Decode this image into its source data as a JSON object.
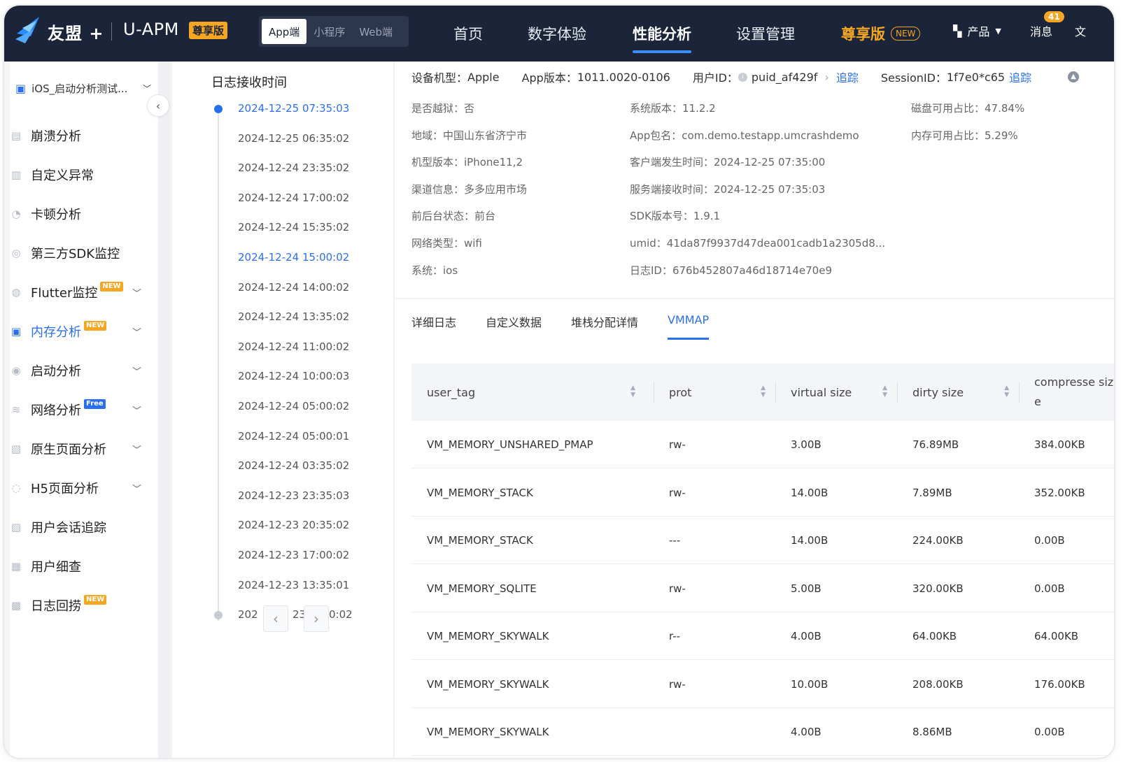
{
  "topbar": {
    "brand": "友盟 +",
    "product": "U-APM",
    "edition_badge": "尊享版",
    "segments": [
      "App端",
      "小程序",
      "Web端"
    ],
    "nav": [
      "首页",
      "数字体验",
      "性能分析",
      "设置管理"
    ],
    "vip_label": "尊享版",
    "vip_new": "NEW",
    "products": "产品",
    "messages": "消息",
    "message_count": "41",
    "docs": "文"
  },
  "sidebar": {
    "app_selector": "iOS_启动分析测试...",
    "items": [
      {
        "label": "崩溃分析",
        "icon": "crash-report-icon"
      },
      {
        "label": "自定义异常",
        "icon": "chart-icon"
      },
      {
        "label": "卡顿分析",
        "icon": "lag-icon"
      },
      {
        "label": "第三方SDK监控",
        "icon": "sdk-monitor-icon"
      },
      {
        "label": "Flutter监控",
        "icon": "flutter-icon",
        "tag": "NEW"
      },
      {
        "label": "内存分析",
        "icon": "memory-save-icon",
        "tag": "NEW"
      },
      {
        "label": "启动分析",
        "icon": "power-icon"
      },
      {
        "label": "网络分析",
        "icon": "wifi-icon",
        "tag": "Free"
      },
      {
        "label": "原生页面分析",
        "icon": "page-icon"
      },
      {
        "label": "H5页面分析",
        "icon": "h5-icon"
      },
      {
        "label": "用户会话追踪",
        "icon": "session-icon"
      },
      {
        "label": "用户细查",
        "icon": "user-detail-icon"
      },
      {
        "label": "日志回捞",
        "icon": "log-icon",
        "tag": "NEW"
      }
    ]
  },
  "timeline": {
    "title": "日志接收时间",
    "items": [
      "2024-12-25 07:35:03",
      "2024-12-25 06:35:02",
      "2024-12-24 23:35:02",
      "2024-12-24 17:00:02",
      "2024-12-24 15:35:02",
      "2024-12-24 15:00:02",
      "2024-12-24 14:00:02",
      "2024-12-24 13:35:02",
      "2024-12-24 11:00:02",
      "2024-12-24 10:00:03",
      "2024-12-24 05:00:02",
      "2024-12-24 05:00:01",
      "2024-12-24 03:35:02",
      "2024-12-23 23:35:03",
      "2024-12-23 20:35:02",
      "2024-12-23 17:00:02",
      "2024-12-23 13:35:01"
    ],
    "last_item_left": "202",
    "last_item_mid": "23",
    "last_item_right": "0:02"
  },
  "detail": {
    "device_model_label": "设备机型：",
    "device_model": "Apple",
    "app_version_label": "App版本：",
    "app_version": "1011.0020-0106",
    "user_id_label": "用户ID：",
    "user_id": "puid_af429f",
    "trace_label": "追踪",
    "session_label": "SessionID：",
    "session_id": "1f7e0*c65",
    "col1": [
      "是否越狱：否",
      "地域：中国山东省济宁市",
      "机型版本：iPhone11,2",
      "渠道信息：多多应用市场",
      "前后台状态：前台",
      "网络类型：wifi",
      "系统：ios"
    ],
    "col2": [
      "系统版本：11.2.2",
      "App包名：com.demo.testapp.umcrashdemo",
      "客户端发生时间：2024-12-25 07:35:00",
      "服务端接收时间：2024-12-25 07:35:03",
      "SDK版本号：1.9.1",
      "umid：41da87f9937d47dea001cadb1a2305d8...",
      "日志ID：676b452807a46d18714e70e9"
    ],
    "col3": [
      "磁盘可用占比：47.84%",
      "内存可用占比：5.29%"
    ]
  },
  "tabs": [
    "详细日志",
    "自定义数据",
    "堆栈分配详情",
    "VMMAP"
  ],
  "table": {
    "headers": [
      "user_tag",
      "prot",
      "virtual size",
      "dirty size",
      "compresse size"
    ],
    "rows": [
      [
        "VM_MEMORY_UNSHARED_PMAP",
        "rw-",
        "3.00B",
        "76.89MB",
        "384.00KB"
      ],
      [
        "VM_MEMORY_STACK",
        "rw-",
        "14.00B",
        "7.89MB",
        "352.00KB"
      ],
      [
        "VM_MEMORY_STACK",
        "---",
        "14.00B",
        "224.00KB",
        "0.00B"
      ],
      [
        "VM_MEMORY_SQLITE",
        "rw-",
        "5.00B",
        "320.00KB",
        "0.00B"
      ],
      [
        "VM_MEMORY_SKYWALK",
        "r--",
        "4.00B",
        "64.00KB",
        "64.00KB"
      ],
      [
        "VM_MEMORY_SKYWALK",
        "rw-",
        "10.00B",
        "208.00KB",
        "176.00KB"
      ],
      [
        "VM_MEMORY_SKYWALK",
        "",
        "4.00B",
        "8.86MB",
        "0.00B"
      ]
    ]
  },
  "colors": {
    "topbar_bg": "#1b2439",
    "accent": "#2a6ff0",
    "vip": "#f5a623"
  }
}
